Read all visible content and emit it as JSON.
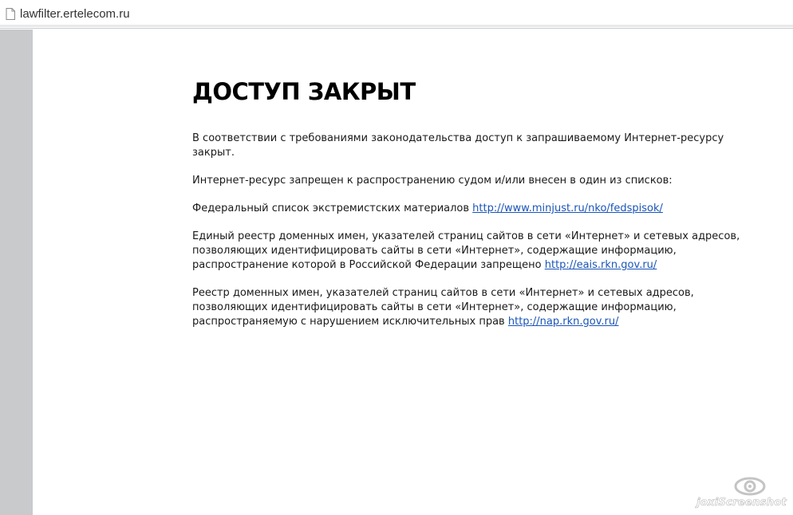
{
  "browser": {
    "url": "lawfilter.ertelecom.ru",
    "page_icon": "page-icon"
  },
  "main": {
    "title": "ДОСТУП ЗАКРЫТ",
    "intro": "В соответствии с требованиями законодательства доступ к запрашиваемому Интернет-ресурсу закрыт.",
    "lists_intro": "Интернет-ресурс запрещен к распространению судом и/или внесен в один из списков:",
    "items": [
      {
        "text": "Федеральный список экстремистских материалов",
        "link": "http://www.minjust.ru/nko/fedspisok/"
      },
      {
        "text": "Единый реестр доменных имен, указателей страниц сайтов в сети «Интернет» и сетевых адресов, позволяющих идентифицировать сайты в сети «Интернет», содержащие информацию, распространение которой в Российской Федерации запрещено",
        "link": "http://eais.rkn.gov.ru/"
      },
      {
        "text": "Реестр доменных имен, указателей страниц сайтов в сети «Интернет» и сетевых адресов, позволяющих идентифицировать сайты в сети «Интернет», содержащие информацию, распространяемую с нарушением исключительных прав",
        "link": "http://nap.rkn.gov.ru/"
      }
    ]
  },
  "watermark": {
    "text": "joxiScreenshot",
    "icon": "eye-logo-icon"
  },
  "colors": {
    "side_panel": "#c8cacc",
    "link": "#1a55b8",
    "text": "#1a1a1a"
  }
}
